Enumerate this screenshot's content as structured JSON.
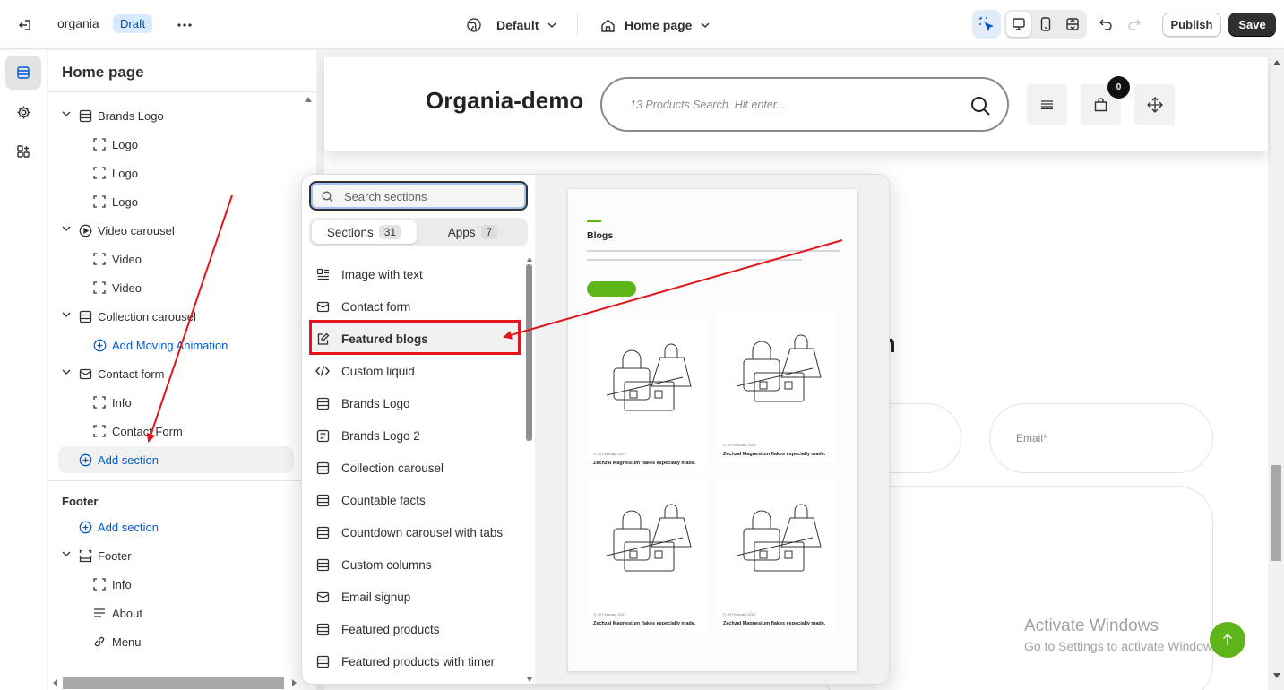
{
  "topbar": {
    "store_name": "organia",
    "status_badge": "Draft",
    "theme_selector": "Default",
    "page_selector": "Home page",
    "publish_label": "Publish",
    "save_label": "Save"
  },
  "sidebar": {
    "title": "Home page",
    "tree": [
      {
        "label": "Brands Logo",
        "type": "section",
        "icon": "section-icon"
      },
      {
        "label": "Logo",
        "type": "block",
        "icon": "block-icon"
      },
      {
        "label": "Logo",
        "type": "block",
        "icon": "block-icon"
      },
      {
        "label": "Logo",
        "type": "block",
        "icon": "block-icon"
      },
      {
        "label": "Video carousel",
        "type": "section",
        "icon": "play-icon"
      },
      {
        "label": "Video",
        "type": "block",
        "icon": "block-icon"
      },
      {
        "label": "Video",
        "type": "block",
        "icon": "block-icon"
      },
      {
        "label": "Collection carousel",
        "type": "section",
        "icon": "section-icon"
      },
      {
        "label": "Add Moving Animation",
        "type": "add",
        "icon": "plus-circle-icon"
      },
      {
        "label": "Contact form",
        "type": "section",
        "icon": "mail-icon"
      },
      {
        "label": "Info",
        "type": "block",
        "icon": "block-icon"
      },
      {
        "label": "Contact Form",
        "type": "block",
        "icon": "block-icon"
      }
    ],
    "add_section_label": "Add section",
    "footer_group_label": "Footer",
    "footer_add_section_label": "Add section",
    "footer_tree": [
      {
        "label": "Footer",
        "type": "section",
        "icon": "footer-icon"
      },
      {
        "label": "Info",
        "type": "block",
        "icon": "block-icon"
      },
      {
        "label": "About",
        "type": "block",
        "icon": "text-lines-icon"
      },
      {
        "label": "Menu",
        "type": "block",
        "icon": "link-icon"
      }
    ]
  },
  "popup": {
    "search_placeholder": "Search sections",
    "tabs": [
      {
        "label": "Sections",
        "count": "31",
        "active": true
      },
      {
        "label": "Apps",
        "count": "7",
        "active": false
      }
    ],
    "items": [
      {
        "label": "Image with text",
        "icon": "image-text-icon"
      },
      {
        "label": "Contact form",
        "icon": "mail-icon"
      },
      {
        "label": "Featured blogs",
        "icon": "edit-icon",
        "highlighted": true
      },
      {
        "label": "Custom liquid",
        "icon": "code-icon"
      },
      {
        "label": "Brands Logo",
        "icon": "section-icon"
      },
      {
        "label": "Brands Logo 2",
        "icon": "doc-icon"
      },
      {
        "label": "Collection carousel",
        "icon": "section-icon"
      },
      {
        "label": "Countable facts",
        "icon": "section-icon"
      },
      {
        "label": "Countdown carousel with tabs",
        "icon": "section-icon"
      },
      {
        "label": "Custom columns",
        "icon": "section-icon"
      },
      {
        "label": "Email signup",
        "icon": "mail-icon"
      },
      {
        "label": "Featured products",
        "icon": "section-icon"
      },
      {
        "label": "Featured products with timer",
        "icon": "section-icon"
      }
    ],
    "preview": {
      "heading": "Blogs",
      "card_title": "Zechzal Magnesium flakes especially made."
    }
  },
  "preview": {
    "logo_text": "Organia-demo",
    "search_placeholder": "13 Products Search. Hit enter...",
    "cart_count": "0",
    "heading_fragment": "m",
    "email_placeholder": "Email*",
    "watermark_title": "Activate Windows",
    "watermark_sub": "Go to Settings to activate Windows."
  },
  "colors": {
    "accent_blue": "#005bd3",
    "highlight_red": "#e3141b",
    "save_bg": "#303030",
    "badge_bg": "#d8eaff",
    "green_button": "#5eb51a"
  }
}
